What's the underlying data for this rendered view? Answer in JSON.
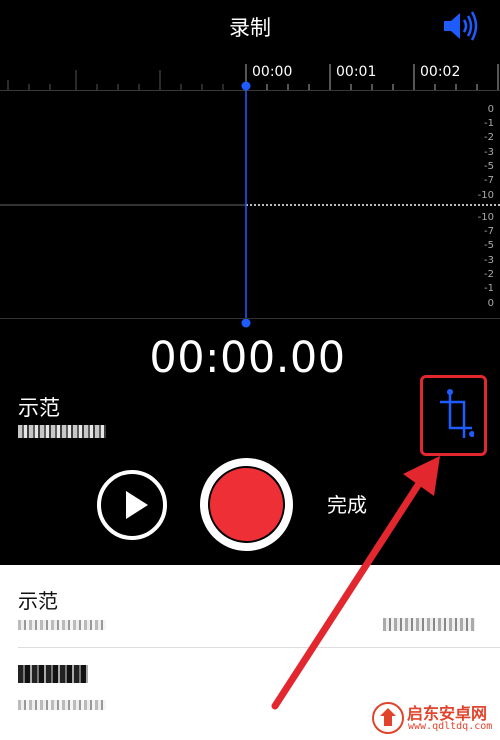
{
  "nav": {
    "title": "录制",
    "speaker_icon": "speaker-volume-icon"
  },
  "ruler": {
    "labels": [
      "00:00",
      "00:01",
      "00:02"
    ]
  },
  "scale": {
    "upper": [
      "0",
      "-1",
      "-2",
      "-3",
      "-5",
      "-7",
      "-10"
    ],
    "lower": [
      "-10",
      "-7",
      "-5",
      "-3",
      "-2",
      "-1",
      "0"
    ]
  },
  "timer": "00:00.00",
  "recording": {
    "name": "示范"
  },
  "controls": {
    "done_label": "完成",
    "trim_icon": "trim-icon"
  },
  "list": {
    "items": [
      {
        "title": "示范"
      },
      {
        "title": ""
      }
    ]
  },
  "colors": {
    "accent": "#1f5cff",
    "record": "#ef2f36",
    "highlight": "#e3272f"
  },
  "watermark": {
    "brand": "启东安卓网",
    "url": "www.qdltdq.com"
  }
}
